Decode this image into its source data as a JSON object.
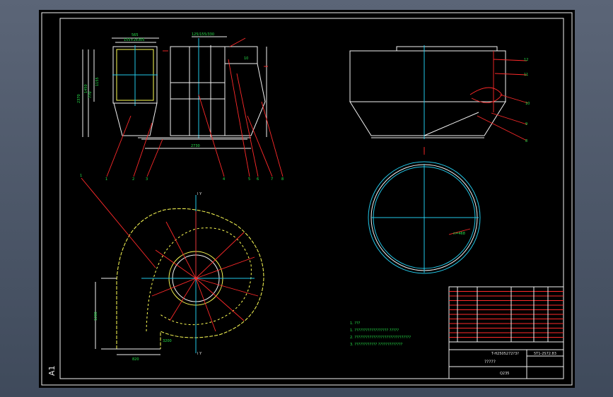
{
  "sheet": {
    "size_label": "A1"
  },
  "front_view": {
    "dims": [
      "565",
      "155+2x305",
      "770",
      "2370",
      "1450",
      "1155",
      "125/155/330",
      "10",
      "2730"
    ],
    "callouts": [
      "1",
      "2",
      "3",
      "4",
      "5",
      "6",
      "7",
      "8"
    ]
  },
  "side_view": {
    "callouts": [
      "12",
      "11",
      "10",
      "9",
      "8",
      "7"
    ]
  },
  "plan_view": {
    "axis_label": "I Y",
    "callout": "1",
    "dims": [
      "1280",
      "1100",
      "820",
      "3200"
    ]
  },
  "ring_view": {
    "dims": [
      "n=468"
    ]
  },
  "notes": [
    "1. ???",
    "1. ?????????????????? ?????",
    "2. ??????????????????????????????",
    "3. ???????????? ?????????????"
  ],
  "title_block": {
    "table_row_count": 12,
    "drawing_no": "5T1-2S72.83",
    "project": "T-H2505272?3?",
    "name": "?????",
    "material": "Q235"
  }
}
